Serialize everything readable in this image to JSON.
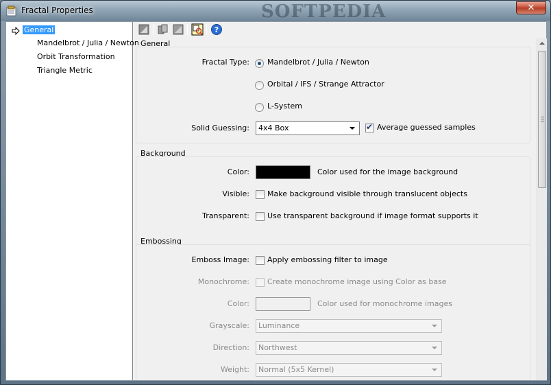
{
  "window": {
    "title": "Fractal Properties",
    "watermark": "SOFTPEDIA",
    "close_glyph": "✕"
  },
  "tree": {
    "items": [
      {
        "label": "General",
        "selected": true
      },
      {
        "label": "Mandelbrot / Julia / Newton"
      },
      {
        "label": "Orbit Transformation"
      },
      {
        "label": "Triangle Metric"
      }
    ]
  },
  "toolbar": {
    "icons": [
      "reset-icon",
      "copy-icon",
      "paste-icon",
      "preview-icon",
      "help-icon"
    ]
  },
  "general": {
    "header": "General",
    "fractal_type_label": "Fractal Type:",
    "options": [
      {
        "label": "Mandelbrot / Julia / Newton",
        "selected": true
      },
      {
        "label": "Orbital / IFS / Strange Attractor",
        "selected": false
      },
      {
        "label": "L-System",
        "selected": false
      }
    ],
    "solid_guessing_label": "Solid Guessing:",
    "solid_guessing_value": "4x4 Box",
    "average_label": "Average guessed samples",
    "average_checked": true
  },
  "background": {
    "header": "Background",
    "color_label": "Color:",
    "color_value": "#000000",
    "color_desc": "Color used for the image background",
    "visible_label": "Visible:",
    "visible_desc": "Make background visible through translucent objects",
    "visible_checked": false,
    "transparent_label": "Transparent:",
    "transparent_desc": "Use transparent background if image format supports it",
    "transparent_checked": false
  },
  "embossing": {
    "header": "Embossing",
    "emboss_label": "Emboss Image:",
    "emboss_desc": "Apply embossing filter to image",
    "emboss_checked": false,
    "mono_label": "Monochrome:",
    "mono_desc": "Create monochrome image using Color as base",
    "mono_checked": false,
    "color_label": "Color:",
    "color_value": "#f0f0f0",
    "color_desc": "Color used for monochrome images",
    "grayscale_label": "Grayscale:",
    "grayscale_value": "Luminance",
    "direction_label": "Direction:",
    "direction_value": "Northwest",
    "weight_label": "Weight:",
    "weight_value": "Normal (5x5 Kernel)"
  }
}
